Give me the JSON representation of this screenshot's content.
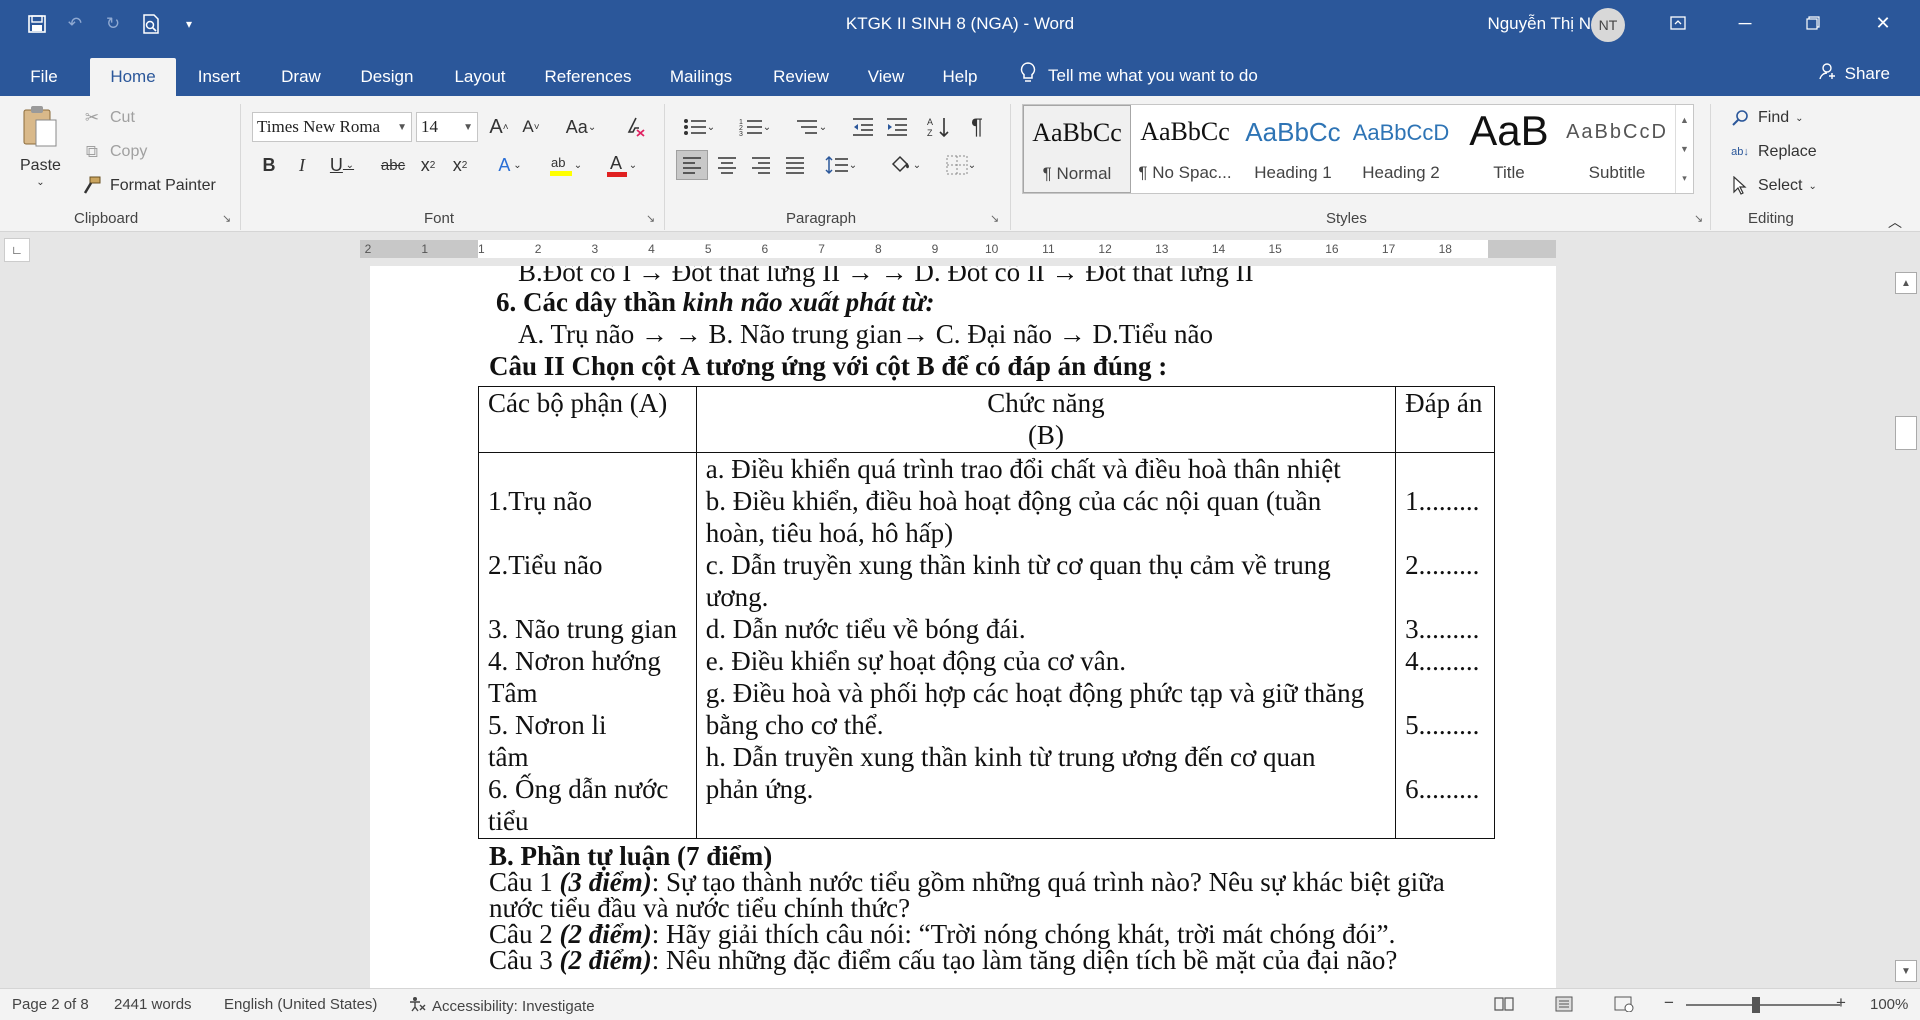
{
  "window": {
    "title": "KTGK II SINH 8 (NGA)  -  Word",
    "user_name": "Nguyễn Thị Nga",
    "user_initials": "NT"
  },
  "quick_access": {
    "icons": [
      "save-icon",
      "undo-icon",
      "redo-icon",
      "print-preview-icon",
      "customize-qat-icon"
    ]
  },
  "menu": {
    "tabs": [
      "File",
      "Home",
      "Insert",
      "Draw",
      "Design",
      "Layout",
      "References",
      "Mailings",
      "Review",
      "View",
      "Help"
    ],
    "active_tab": "Home",
    "tell_me": "Tell me what you want to do",
    "share": "Share"
  },
  "ribbon": {
    "clipboard": {
      "label": "Clipboard",
      "paste": "Paste",
      "cut": "Cut",
      "copy": "Copy",
      "format_painter": "Format Painter"
    },
    "font": {
      "label": "Font",
      "font_name": "Times New Roma",
      "font_size": "14",
      "font_color": "#e02020",
      "highlight_color": "#ffff00"
    },
    "paragraph": {
      "label": "Paragraph"
    },
    "styles": {
      "label": "Styles",
      "items": [
        {
          "sample": "AaBbCc",
          "name": "¶ Normal"
        },
        {
          "sample": "AaBbCc",
          "name": "¶ No Spac..."
        },
        {
          "sample": "AaBbCc",
          "name": "Heading 1"
        },
        {
          "sample": "AaBbCcD",
          "name": "Heading 2"
        },
        {
          "sample": "AaB",
          "name": "Title"
        },
        {
          "sample": "AaBbCcD",
          "name": "Subtitle"
        }
      ]
    },
    "editing": {
      "label": "Editing",
      "find": "Find",
      "replace": "Replace",
      "select": "Select"
    }
  },
  "ruler": {
    "ticks": [
      "2",
      "1",
      "1",
      "2",
      "3",
      "4",
      "5",
      "6",
      "7",
      "8",
      "9",
      "10",
      "11",
      "12",
      "13",
      "14",
      "15",
      "16",
      "17",
      "18"
    ]
  },
  "document": {
    "line_partial": "B.Đốt cổ I → Đốt thắt lưng II   →      →   D. Đốt cổ II → Đốt thắt lưng II",
    "q6_num": "6. Các dây thần ",
    "q6_italic": "kinh não xuất phát từ:",
    "q6_options": "A.  Trụ não  →      →   B. Não trung gian→   C. Đại não   →   D.Tiểu não",
    "q2_heading": "Câu II  Chọn cột A tương ứng với cột B để có đáp án đúng :",
    "table": {
      "header_a": "Các bộ phận (A)",
      "header_b1": "Chức năng",
      "header_b2": "(B)",
      "header_c": "Đáp án",
      "col_a": [
        "",
        "1.Trụ não",
        "",
        "2.Tiểu não",
        "",
        "3. Não trung gian",
        "4. Nơron hướng",
        "Tâm",
        "5. Nơron li",
        "tâm",
        "6. Ống dẫn nước",
        "tiểu"
      ],
      "col_b": [
        "a. Điều khiển quá trình trao đổi chất và điều hoà thân nhiệt",
        "b. Điều khiển, điều hoà hoạt động của các nội quan (tuần",
        "hoàn, tiêu hoá, hô hấp)",
        "c. Dẫn truyền xung thần kinh từ cơ quan thụ cảm về trung",
        "ương.",
        "d. Dẫn nước tiểu về bóng đái.",
        "e. Điều khiển sự hoạt động của cơ vân.",
        "g. Điều hoà và phối hợp các hoạt động phức tạp và giữ thăng",
        "bằng cho cơ thể.",
        "h. Dẫn truyền xung thần kinh từ trung ương đến cơ quan",
        "phản ứng.",
        ""
      ],
      "col_c": [
        "",
        "1.........",
        "",
        "2.........",
        "",
        "3.........",
        "4.........",
        "",
        "5.........",
        "",
        "6.........",
        ""
      ]
    },
    "part_b": "B. Phần tự luận (7 điểm)",
    "c1_prefix": "Câu 1 ",
    "c1_points": "(3 điểm)",
    "c1_text": ": Sự tạo thành nước tiểu gồm những quá trình nào? Nêu sự khác biệt giữa",
    "c1_text2": "nước tiểu đầu và nước tiểu chính thức?",
    "c2_prefix": "Câu 2 ",
    "c2_points": "(2 điểm)",
    "c2_text": ":  Hãy giải thích câu nói: “Trời nóng chóng khát, trời mát chóng đói”.",
    "c3_prefix": "Câu 3 ",
    "c3_points": "(2 điểm)",
    "c3_text": ":  Nêu những đặc điểm cấu tạo làm tăng diện tích bề mặt của đại não?"
  },
  "status": {
    "page": "Page 2 of 8",
    "words": "2441 words",
    "language": "English (United States)",
    "accessibility": "Accessibility: Investigate",
    "zoom": "100%"
  }
}
